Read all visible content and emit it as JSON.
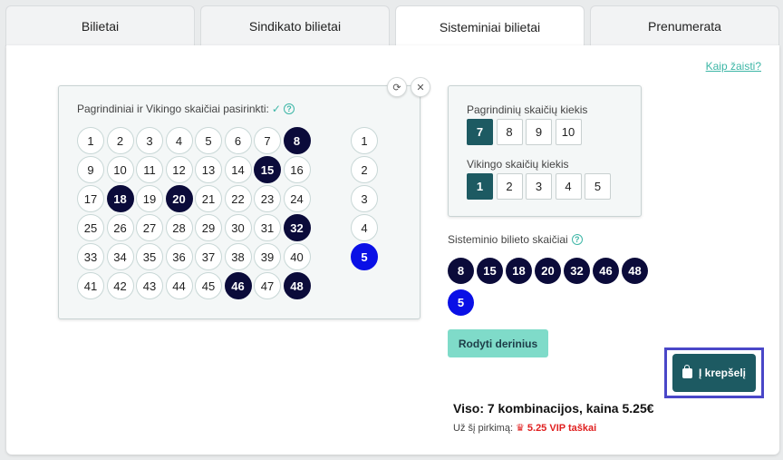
{
  "tabs": [
    "Bilietai",
    "Sindikato bilietai",
    "Sisteminiai bilietai",
    "Prenumerata"
  ],
  "active_tab": 2,
  "help_link": "Kaip žaisti?",
  "grid": {
    "label": "Pagrindiniai ir Vikingo skaičiai pasirinkti:",
    "check": "✓",
    "help": "?",
    "refresh_icon": "⟳",
    "close_icon": "✕",
    "main_numbers": [
      1,
      2,
      3,
      4,
      5,
      6,
      7,
      8,
      9,
      10,
      11,
      12,
      13,
      14,
      15,
      16,
      17,
      18,
      19,
      20,
      21,
      22,
      23,
      24,
      25,
      26,
      27,
      28,
      29,
      30,
      31,
      32,
      33,
      34,
      35,
      36,
      37,
      38,
      39,
      40,
      41,
      42,
      43,
      44,
      45,
      46,
      47,
      48
    ],
    "selected_main": [
      8,
      15,
      18,
      20,
      32,
      46,
      48
    ],
    "viking_numbers": [
      1,
      2,
      3,
      4,
      5
    ],
    "selected_viking": [
      5
    ]
  },
  "quantity": {
    "main_label": "Pagrindinių skaičių kiekis",
    "main_options": [
      7,
      8,
      9,
      10
    ],
    "main_selected": 7,
    "viking_label": "Vikingo skaičių kiekis",
    "viking_options": [
      1,
      2,
      3,
      4,
      5
    ],
    "viking_selected": 1
  },
  "system": {
    "label": "Sisteminio bilieto skaičiai",
    "help": "?",
    "numbers": [
      8,
      15,
      18,
      20,
      32,
      46,
      48
    ],
    "viking": [
      5
    ]
  },
  "show_button": "Rodyti derinius",
  "total": "Viso: 7 kombinacijos, kaina 5.25€",
  "vip": {
    "label": "Už šį pirkimą:",
    "crown": "♛",
    "value": "5.25 VIP taškai"
  },
  "cart_button": "Į krepšelį",
  "colors": {
    "accent": "#3cb6a6",
    "dark_teal": "#1d5a62",
    "navy": "#0b0b3a",
    "blue": "#0a10e6",
    "mint": "#7fdbc9"
  }
}
